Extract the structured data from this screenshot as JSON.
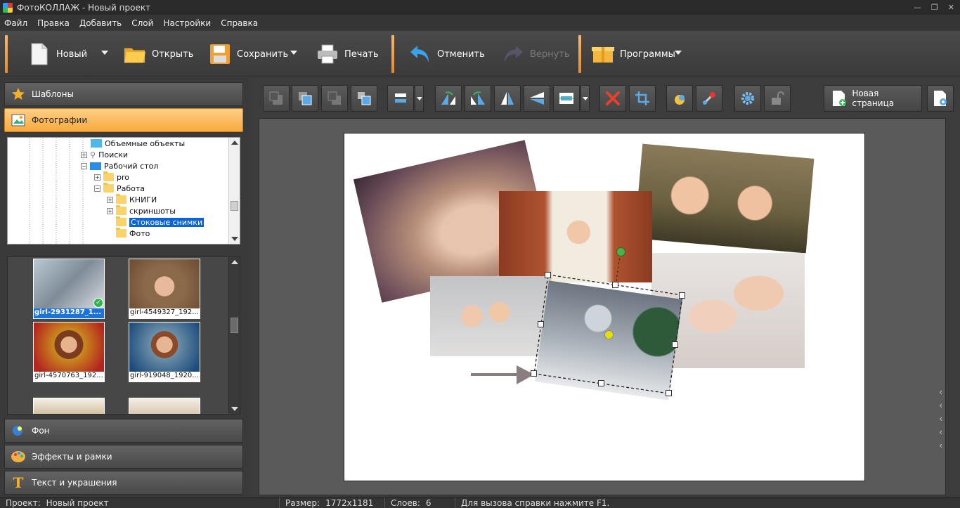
{
  "window": {
    "title": "ФотоКОЛЛАЖ - Новый проект"
  },
  "menu": [
    "Файл",
    "Правка",
    "Добавить",
    "Слой",
    "Настройки",
    "Справка"
  ],
  "main_toolbar": {
    "new": "Новый",
    "open": "Открыть",
    "save": "Сохранить",
    "print": "Печать",
    "undo": "Отменить",
    "redo": "Вернуть",
    "programs": "Программы"
  },
  "left_panel": {
    "templates": "Шаблоны",
    "photos": "Фотографии",
    "background": "Фон",
    "effects": "Эффекты и рамки",
    "text": "Текст и украшения"
  },
  "tree": {
    "items": [
      {
        "label": "Объемные объекты",
        "kind": "3d-objects"
      },
      {
        "label": "Поиски",
        "kind": "search"
      },
      {
        "label": "Рабочий стол",
        "kind": "desktop"
      },
      {
        "label": "pro",
        "kind": "folder"
      },
      {
        "label": "Работа",
        "kind": "folder"
      },
      {
        "label": "КНИГИ",
        "kind": "folder"
      },
      {
        "label": "скриншоты",
        "kind": "folder"
      },
      {
        "label": "Стоковые снимки",
        "kind": "folder",
        "selected": true
      },
      {
        "label": "Фото",
        "kind": "folder"
      }
    ]
  },
  "thumbnails": [
    {
      "name": "girl-2931287_1...",
      "selected": true
    },
    {
      "name": "girl-4549327_192..."
    },
    {
      "name": "girl-4570763_192..."
    },
    {
      "name": "girl-919048_1920...."
    }
  ],
  "edit_toolbar": {
    "new_page": "Новая страница"
  },
  "status": {
    "project_label": "Проект:",
    "project_value": "Новый проект",
    "size_label": "Размер:",
    "size_value": "1772x1181",
    "layers_label": "Слоев:",
    "layers_value": "6",
    "hint": "Для вызова справки нажмите F1."
  },
  "colors": {
    "accent": "#f7a93b",
    "selection": "#1b74dc",
    "handle_rotate": "#4caf50",
    "handle_center": "#e6e000"
  }
}
